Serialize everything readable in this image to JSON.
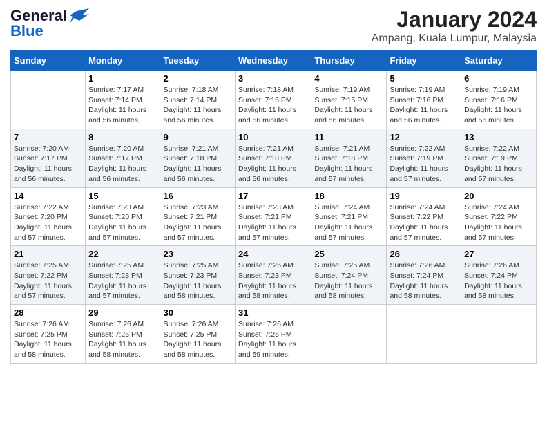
{
  "header": {
    "logo_line1": "General",
    "logo_line2": "Blue",
    "title": "January 2024",
    "subtitle": "Ampang, Kuala Lumpur, Malaysia"
  },
  "days_of_week": [
    "Sunday",
    "Monday",
    "Tuesday",
    "Wednesday",
    "Thursday",
    "Friday",
    "Saturday"
  ],
  "weeks": [
    [
      {
        "num": "",
        "sunrise": "",
        "sunset": "",
        "daylight": ""
      },
      {
        "num": "1",
        "sunrise": "Sunrise: 7:17 AM",
        "sunset": "Sunset: 7:14 PM",
        "daylight": "Daylight: 11 hours and 56 minutes."
      },
      {
        "num": "2",
        "sunrise": "Sunrise: 7:18 AM",
        "sunset": "Sunset: 7:14 PM",
        "daylight": "Daylight: 11 hours and 56 minutes."
      },
      {
        "num": "3",
        "sunrise": "Sunrise: 7:18 AM",
        "sunset": "Sunset: 7:15 PM",
        "daylight": "Daylight: 11 hours and 56 minutes."
      },
      {
        "num": "4",
        "sunrise": "Sunrise: 7:19 AM",
        "sunset": "Sunset: 7:15 PM",
        "daylight": "Daylight: 11 hours and 56 minutes."
      },
      {
        "num": "5",
        "sunrise": "Sunrise: 7:19 AM",
        "sunset": "Sunset: 7:16 PM",
        "daylight": "Daylight: 11 hours and 56 minutes."
      },
      {
        "num": "6",
        "sunrise": "Sunrise: 7:19 AM",
        "sunset": "Sunset: 7:16 PM",
        "daylight": "Daylight: 11 hours and 56 minutes."
      }
    ],
    [
      {
        "num": "7",
        "sunrise": "Sunrise: 7:20 AM",
        "sunset": "Sunset: 7:17 PM",
        "daylight": "Daylight: 11 hours and 56 minutes."
      },
      {
        "num": "8",
        "sunrise": "Sunrise: 7:20 AM",
        "sunset": "Sunset: 7:17 PM",
        "daylight": "Daylight: 11 hours and 56 minutes."
      },
      {
        "num": "9",
        "sunrise": "Sunrise: 7:21 AM",
        "sunset": "Sunset: 7:18 PM",
        "daylight": "Daylight: 11 hours and 56 minutes."
      },
      {
        "num": "10",
        "sunrise": "Sunrise: 7:21 AM",
        "sunset": "Sunset: 7:18 PM",
        "daylight": "Daylight: 11 hours and 56 minutes."
      },
      {
        "num": "11",
        "sunrise": "Sunrise: 7:21 AM",
        "sunset": "Sunset: 7:18 PM",
        "daylight": "Daylight: 11 hours and 57 minutes."
      },
      {
        "num": "12",
        "sunrise": "Sunrise: 7:22 AM",
        "sunset": "Sunset: 7:19 PM",
        "daylight": "Daylight: 11 hours and 57 minutes."
      },
      {
        "num": "13",
        "sunrise": "Sunrise: 7:22 AM",
        "sunset": "Sunset: 7:19 PM",
        "daylight": "Daylight: 11 hours and 57 minutes."
      }
    ],
    [
      {
        "num": "14",
        "sunrise": "Sunrise: 7:22 AM",
        "sunset": "Sunset: 7:20 PM",
        "daylight": "Daylight: 11 hours and 57 minutes."
      },
      {
        "num": "15",
        "sunrise": "Sunrise: 7:23 AM",
        "sunset": "Sunset: 7:20 PM",
        "daylight": "Daylight: 11 hours and 57 minutes."
      },
      {
        "num": "16",
        "sunrise": "Sunrise: 7:23 AM",
        "sunset": "Sunset: 7:21 PM",
        "daylight": "Daylight: 11 hours and 57 minutes."
      },
      {
        "num": "17",
        "sunrise": "Sunrise: 7:23 AM",
        "sunset": "Sunset: 7:21 PM",
        "daylight": "Daylight: 11 hours and 57 minutes."
      },
      {
        "num": "18",
        "sunrise": "Sunrise: 7:24 AM",
        "sunset": "Sunset: 7:21 PM",
        "daylight": "Daylight: 11 hours and 57 minutes."
      },
      {
        "num": "19",
        "sunrise": "Sunrise: 7:24 AM",
        "sunset": "Sunset: 7:22 PM",
        "daylight": "Daylight: 11 hours and 57 minutes."
      },
      {
        "num": "20",
        "sunrise": "Sunrise: 7:24 AM",
        "sunset": "Sunset: 7:22 PM",
        "daylight": "Daylight: 11 hours and 57 minutes."
      }
    ],
    [
      {
        "num": "21",
        "sunrise": "Sunrise: 7:25 AM",
        "sunset": "Sunset: 7:22 PM",
        "daylight": "Daylight: 11 hours and 57 minutes."
      },
      {
        "num": "22",
        "sunrise": "Sunrise: 7:25 AM",
        "sunset": "Sunset: 7:23 PM",
        "daylight": "Daylight: 11 hours and 57 minutes."
      },
      {
        "num": "23",
        "sunrise": "Sunrise: 7:25 AM",
        "sunset": "Sunset: 7:23 PM",
        "daylight": "Daylight: 11 hours and 58 minutes."
      },
      {
        "num": "24",
        "sunrise": "Sunrise: 7:25 AM",
        "sunset": "Sunset: 7:23 PM",
        "daylight": "Daylight: 11 hours and 58 minutes."
      },
      {
        "num": "25",
        "sunrise": "Sunrise: 7:25 AM",
        "sunset": "Sunset: 7:24 PM",
        "daylight": "Daylight: 11 hours and 58 minutes."
      },
      {
        "num": "26",
        "sunrise": "Sunrise: 7:26 AM",
        "sunset": "Sunset: 7:24 PM",
        "daylight": "Daylight: 11 hours and 58 minutes."
      },
      {
        "num": "27",
        "sunrise": "Sunrise: 7:26 AM",
        "sunset": "Sunset: 7:24 PM",
        "daylight": "Daylight: 11 hours and 58 minutes."
      }
    ],
    [
      {
        "num": "28",
        "sunrise": "Sunrise: 7:26 AM",
        "sunset": "Sunset: 7:25 PM",
        "daylight": "Daylight: 11 hours and 58 minutes."
      },
      {
        "num": "29",
        "sunrise": "Sunrise: 7:26 AM",
        "sunset": "Sunset: 7:25 PM",
        "daylight": "Daylight: 11 hours and 58 minutes."
      },
      {
        "num": "30",
        "sunrise": "Sunrise: 7:26 AM",
        "sunset": "Sunset: 7:25 PM",
        "daylight": "Daylight: 11 hours and 58 minutes."
      },
      {
        "num": "31",
        "sunrise": "Sunrise: 7:26 AM",
        "sunset": "Sunset: 7:25 PM",
        "daylight": "Daylight: 11 hours and 59 minutes."
      },
      {
        "num": "",
        "sunrise": "",
        "sunset": "",
        "daylight": ""
      },
      {
        "num": "",
        "sunrise": "",
        "sunset": "",
        "daylight": ""
      },
      {
        "num": "",
        "sunrise": "",
        "sunset": "",
        "daylight": ""
      }
    ]
  ]
}
